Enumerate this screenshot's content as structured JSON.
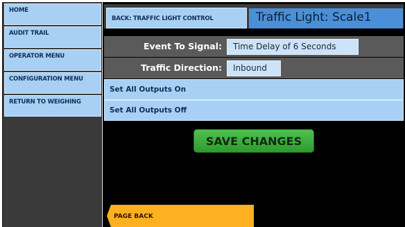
{
  "sidebar": {
    "items": [
      {
        "label": "HOME"
      },
      {
        "label": "AUDIT TRAIL"
      },
      {
        "label": "OPERATOR MENU"
      },
      {
        "label": "CONFIGURATION MENU"
      },
      {
        "label": "RETURN TO WEIGHING"
      }
    ]
  },
  "header": {
    "back_label": "BACK: TRAFFIC LIGHT CONTROL",
    "title": "Traffic Light: Scale1"
  },
  "fields": {
    "event": {
      "label": "Event To Signal:",
      "value": "Time Delay of 6 Seconds"
    },
    "direction": {
      "label": "Traffic Direction:",
      "value": "Inbound"
    }
  },
  "actions": {
    "all_on": "Set All Outputs On",
    "all_off": "Set All Outputs Off"
  },
  "save_label": "SAVE CHANGES",
  "page_back_label": "PAGE BACK",
  "colors": {
    "button_blue": "#a8d0f4",
    "title_blue": "#4a8fd8",
    "save_green": "#3aad3a",
    "page_back_orange": "#ffb020",
    "panel_gray": "#5a5a5a",
    "background": "#000000"
  }
}
